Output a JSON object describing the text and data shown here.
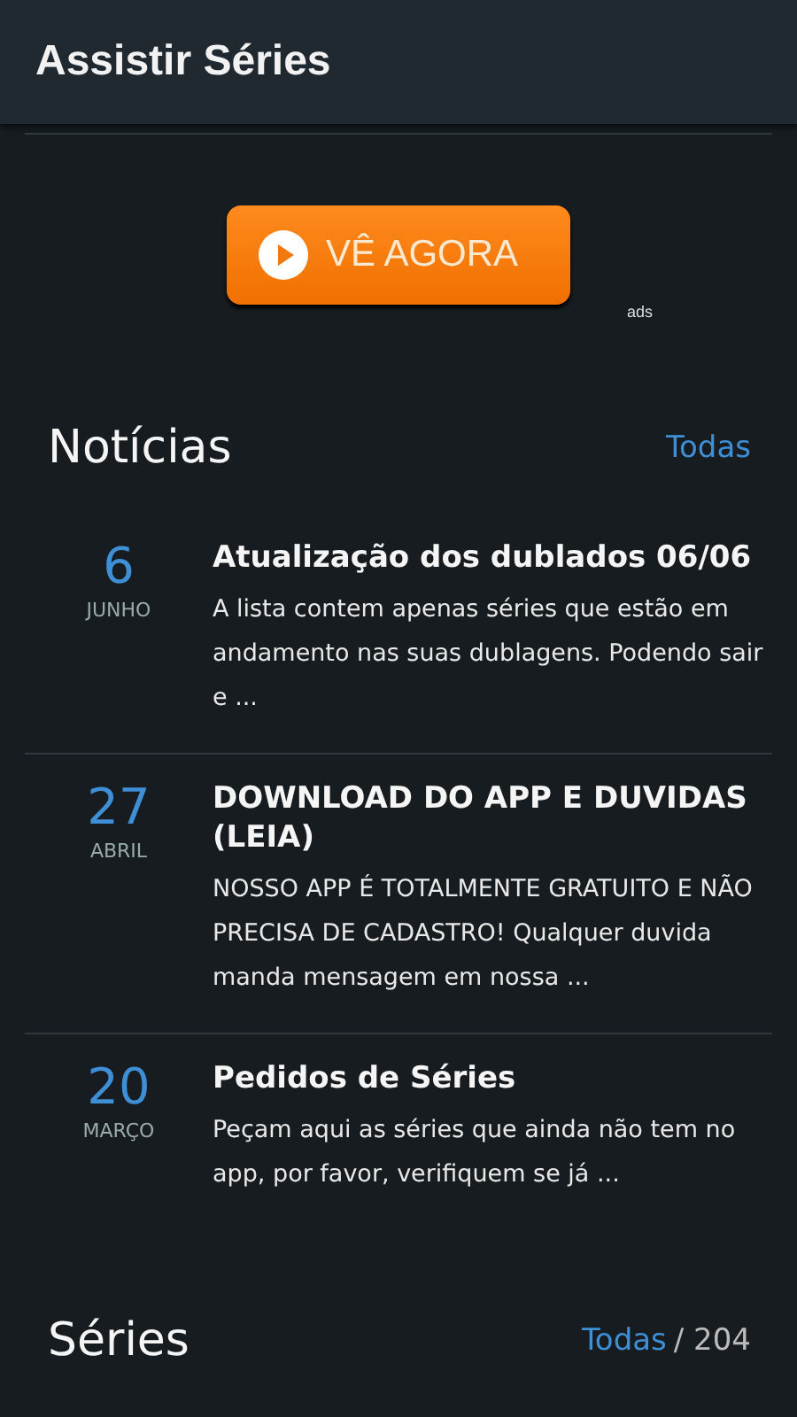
{
  "app_bar": {
    "title": "Assistir Séries"
  },
  "ad": {
    "button": "VÊ AGORA",
    "label": "ads"
  },
  "news": {
    "title": "Notícias",
    "link": "Todas",
    "items": [
      {
        "day": "6",
        "month": "JUNHO",
        "title": "Atualização dos dublados 06/06",
        "excerpt": "A lista contem apenas séries que estão em andamento nas suas dublagens. Podendo sair e ..."
      },
      {
        "day": "27",
        "month": "ABRIL",
        "title": "DOWNLOAD DO APP E DUVIDAS (LEIA)",
        "excerpt": "NOSSO APP É TOTALMENTE GRATUITO E NÃO PRECISA DE CADASTRO! Qualquer duvida manda mensagem em nossa ..."
      },
      {
        "day": "20",
        "month": "MARÇO",
        "title": "Pedidos de Séries",
        "excerpt": "Peçam aqui as séries que ainda não tem no app, por favor, verifiquem se já ..."
      }
    ]
  },
  "series": {
    "title": "Séries",
    "link": "Todas",
    "count": "/ 204"
  }
}
